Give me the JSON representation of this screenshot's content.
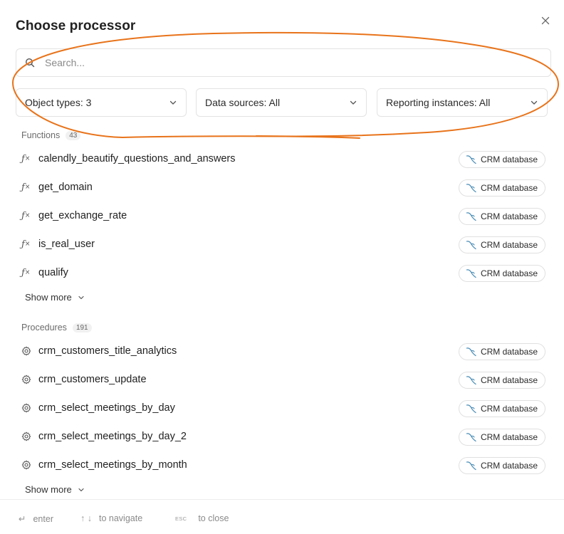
{
  "dialog": {
    "title": "Choose processor"
  },
  "search": {
    "placeholder": "Search..."
  },
  "filters": {
    "object_types": "Object types: 3",
    "data_sources": "Data sources: All",
    "reporting_instances": "Reporting instances: All"
  },
  "functions": {
    "label": "Functions",
    "count": "43",
    "items": [
      {
        "name": "calendly_beautify_questions_and_answers",
        "source": "CRM database"
      },
      {
        "name": "get_domain",
        "source": "CRM database"
      },
      {
        "name": "get_exchange_rate",
        "source": "CRM database"
      },
      {
        "name": "is_real_user",
        "source": "CRM database"
      },
      {
        "name": "qualify",
        "source": "CRM database"
      }
    ],
    "show_more": "Show more"
  },
  "procedures": {
    "label": "Procedures",
    "count": "191",
    "items": [
      {
        "name": "crm_customers_title_analytics",
        "source": "CRM database"
      },
      {
        "name": "crm_customers_update",
        "source": "CRM database"
      },
      {
        "name": "crm_select_meetings_by_day",
        "source": "CRM database"
      },
      {
        "name": "crm_select_meetings_by_day_2",
        "source": "CRM database"
      },
      {
        "name": "crm_select_meetings_by_month",
        "source": "CRM database"
      }
    ],
    "show_more": "Show more"
  },
  "footer": {
    "enter_key": "↵",
    "enter_label": "enter",
    "nav_keys": "↑ ↓",
    "nav_label": "to navigate",
    "esc_key": "ESC",
    "esc_label": "to close"
  },
  "colors": {
    "annotation": "#e8731a",
    "mysql_icon": "#4d8fb8"
  }
}
